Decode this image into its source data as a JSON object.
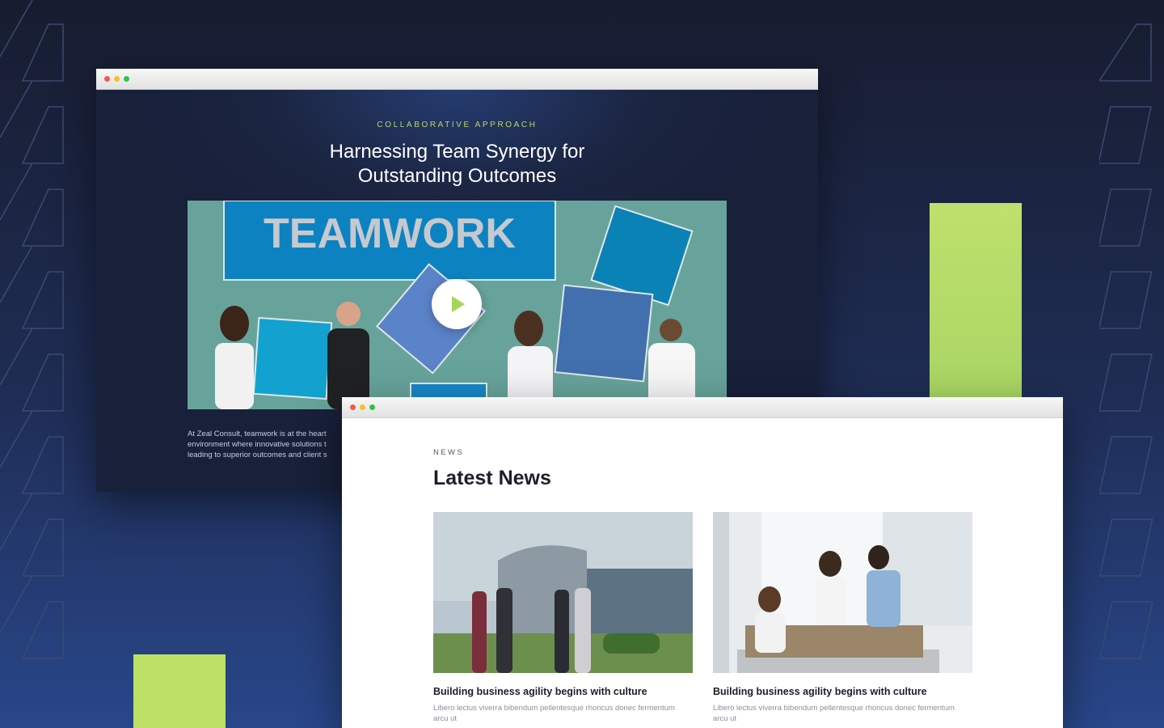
{
  "hero": {
    "eyebrow": "COLLABORATIVE APPROACH",
    "title": "Harnessing Team Synergy for Outstanding Outcomes",
    "video_banner_text": "TEAMWORK",
    "intro_lines": [
      "At Zeal Consult, teamwork is at the heart",
      "environment where innovative solutions t",
      "leading to superior outcomes and client s"
    ]
  },
  "news": {
    "eyebrow": "NEWS",
    "title": "Latest News",
    "cards": [
      {
        "title": "Building business agility begins with culture",
        "excerpt": "Libero lectus viverra bibendum pellentesque rhoncus donec fermentum  arcu ut"
      },
      {
        "title": "Building business agility begins with culture",
        "excerpt": "Libero lectus viverra bibendum pellentesque rhoncus donec fermentum  arcu ut"
      }
    ]
  },
  "colors": {
    "accent_green": "#b7dd68",
    "background_navy": "#1f2d55",
    "video_teal": "#67a39b"
  },
  "icons": {
    "play": "play-icon"
  }
}
